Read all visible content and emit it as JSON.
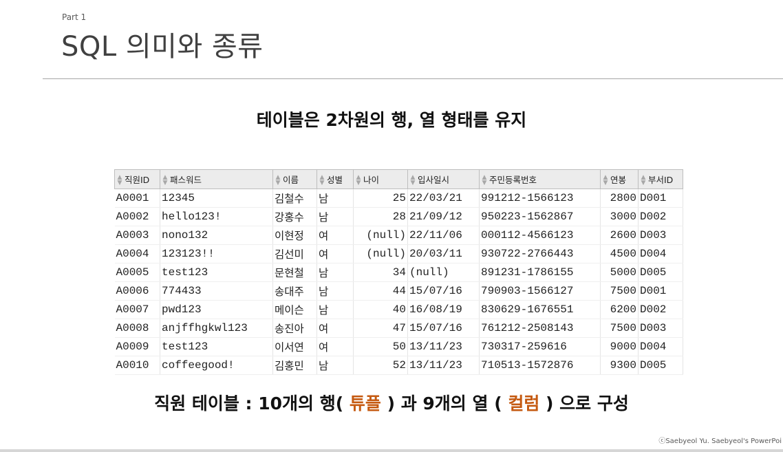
{
  "slide": {
    "part_label": "Part 1",
    "title": "SQL 의미와 종류",
    "subtitle": "테이블은 2차원의 행, 열 형태를 유지",
    "footer": {
      "prefix": "직원 테이블 : 10개의 행( ",
      "tuple_word": "튜플",
      "middle": " ) 과 9개의 열 ( ",
      "column_word": "컬럼",
      "suffix": " ) 으로 구성",
      "highlight_color": "#c55a11"
    },
    "copyright": "ⓒSaebyeol Yu. Saebyeol's PowerPoi"
  },
  "table": {
    "sort_icon": "sort-arrows-icon",
    "headers": [
      "직원ID",
      "패스워드",
      "이름",
      "성별",
      "나이",
      "입사일시",
      "주민등록번호",
      "연봉",
      "부서ID"
    ],
    "rows": [
      [
        "A0001",
        "12345",
        "김철수",
        "남",
        "25",
        "22/03/21",
        "991212-1566123",
        "2800",
        "D001"
      ],
      [
        "A0002",
        "hello123!",
        "강홍수",
        "남",
        "28",
        "21/09/12",
        "950223-1562867",
        "3000",
        "D002"
      ],
      [
        "A0003",
        "nono132",
        "이현정",
        "여",
        "(null)",
        "22/11/06",
        "000112-4566123",
        "2600",
        "D003"
      ],
      [
        "A0004",
        "123123!!",
        "김선미",
        "여",
        "(null)",
        "20/03/11",
        "930722-2766443",
        "4500",
        "D004"
      ],
      [
        "A0005",
        "test123",
        "문현철",
        "남",
        "34",
        "(null)",
        "891231-1786155",
        "5000",
        "D005"
      ],
      [
        "A0006",
        "774433",
        "송대주",
        "남",
        "44",
        "15/07/16",
        "790903-1566127",
        "7500",
        "D001"
      ],
      [
        "A0007",
        "pwd123",
        "메이슨",
        "남",
        "40",
        "16/08/19",
        "830629-1676551",
        "6200",
        "D002"
      ],
      [
        "A0008",
        "anjffhgkwl123",
        "송진아",
        "여",
        "47",
        "15/07/16",
        "761212-2508143",
        "7500",
        "D003"
      ],
      [
        "A0009",
        "test123",
        "이서연",
        "여",
        "50",
        "13/11/23",
        "730317-259616",
        "9000",
        "D004"
      ],
      [
        "A0010",
        "coffeegood!",
        "김홍민",
        "남",
        "52",
        "13/11/23",
        "710513-1572876",
        "9300",
        "D005"
      ]
    ]
  }
}
